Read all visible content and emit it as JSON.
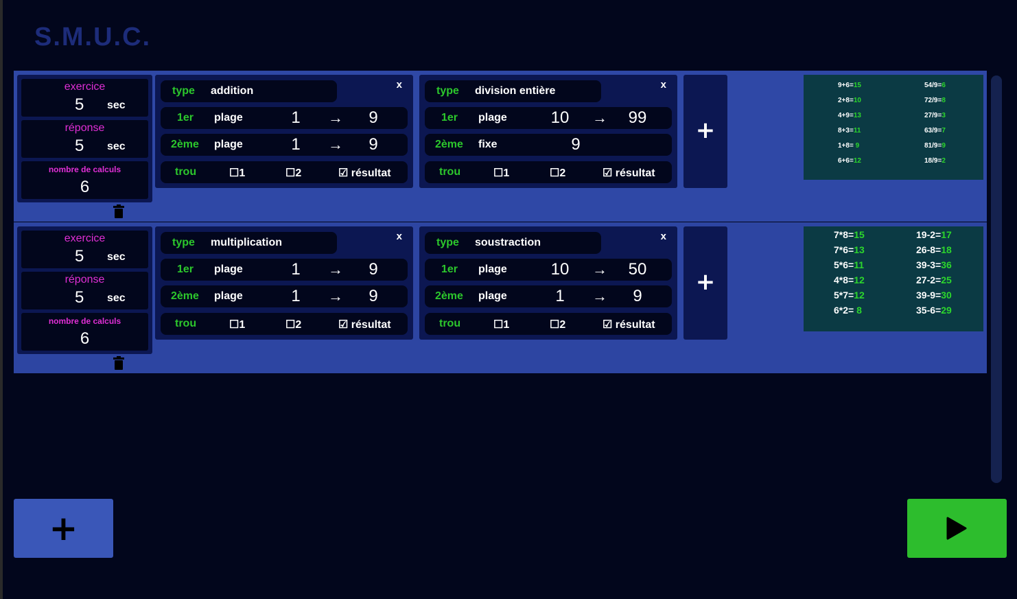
{
  "app": {
    "logo": "S.M.U.C."
  },
  "groups": [
    {
      "settings": {
        "exercise_label": "exercice",
        "exercise_value": "5",
        "exercise_unit": "sec",
        "answer_label": "réponse",
        "answer_value": "5",
        "answer_unit": "sec",
        "count_label": "nombre de calculs",
        "count_value": "6"
      },
      "operations": [
        {
          "type_label": "type",
          "type_value": "addition",
          "close": "x",
          "first_label": "1er",
          "first_mode": "plage",
          "first_from": "1",
          "first_arrow": "→",
          "first_to": "9",
          "second_label": "2ème",
          "second_mode": "plage",
          "second_from": "1",
          "second_arrow": "→",
          "second_to": "9",
          "hole_label": "trou",
          "hole_1": "☐1",
          "hole_2": "☐2",
          "hole_result": "☑ résultat"
        },
        {
          "type_label": "type",
          "type_value": "division entière",
          "close": "x",
          "first_label": "1er",
          "first_mode": "plage",
          "first_from": "10",
          "first_arrow": "→",
          "first_to": "99",
          "second_label": "2ème",
          "second_mode": "fixe",
          "second_from": "9",
          "second_arrow": "",
          "second_to": "",
          "hole_label": "trou",
          "hole_1": "☐1",
          "hole_2": "☐2",
          "hole_result": "☑ résultat"
        }
      ],
      "add_operation": "+",
      "preview": {
        "col1": [
          {
            "q": "9+6=",
            "a": "15"
          },
          {
            "q": "2+8=",
            "a": "10"
          },
          {
            "q": "4+9=",
            "a": "13"
          },
          {
            "q": "8+3=",
            "a": "11"
          },
          {
            "q": "1+8=",
            "a": " 9"
          },
          {
            "q": "6+6=",
            "a": "12"
          }
        ],
        "col2": [
          {
            "q": "54/9=",
            "a": "6"
          },
          {
            "q": "72/9=",
            "a": "8"
          },
          {
            "q": "27/9=",
            "a": "3"
          },
          {
            "q": "63/9=",
            "a": "7"
          },
          {
            "q": "81/9=",
            "a": "9"
          },
          {
            "q": "18/9=",
            "a": "2"
          }
        ]
      }
    },
    {
      "settings": {
        "exercise_label": "exercice",
        "exercise_value": "5",
        "exercise_unit": "sec",
        "answer_label": "réponse",
        "answer_value": "5",
        "answer_unit": "sec",
        "count_label": "nombre de calculs",
        "count_value": "6"
      },
      "operations": [
        {
          "type_label": "type",
          "type_value": "multiplication",
          "close": "x",
          "first_label": "1er",
          "first_mode": "plage",
          "first_from": "1",
          "first_arrow": "→",
          "first_to": "9",
          "second_label": "2ème",
          "second_mode": "plage",
          "second_from": "1",
          "second_arrow": "→",
          "second_to": "9",
          "hole_label": "trou",
          "hole_1": "☐1",
          "hole_2": "☐2",
          "hole_result": "☑ résultat"
        },
        {
          "type_label": "type",
          "type_value": "soustraction",
          "close": "x",
          "first_label": "1er",
          "first_mode": "plage",
          "first_from": "10",
          "first_arrow": "→",
          "first_to": "50",
          "second_label": "2ème",
          "second_mode": "plage",
          "second_from": "1",
          "second_arrow": "→",
          "second_to": "9",
          "hole_label": "trou",
          "hole_1": "☐1",
          "hole_2": "☐2",
          "hole_result": "☑ résultat"
        }
      ],
      "add_operation": "+",
      "preview": {
        "col1": [
          {
            "q": "7*8=",
            "a": "15"
          },
          {
            "q": "7*6=",
            "a": "13"
          },
          {
            "q": "5*6=",
            "a": "11"
          },
          {
            "q": "4*8=",
            "a": "12"
          },
          {
            "q": "5*7=",
            "a": "12"
          },
          {
            "q": "6*2=",
            "a": " 8"
          }
        ],
        "col2": [
          {
            "q": "19-2=",
            "a": "17"
          },
          {
            "q": "26-8=",
            "a": "18"
          },
          {
            "q": "39-3=",
            "a": "36"
          },
          {
            "q": "27-2=",
            "a": "25"
          },
          {
            "q": "39-9=",
            "a": "30"
          },
          {
            "q": "35-6=",
            "a": "29"
          }
        ]
      }
    }
  ],
  "controls": {
    "add_group": "+",
    "play_icon": "play-icon"
  },
  "colors": {
    "background": "#02061c",
    "group": "#2f48a6",
    "panel": "#0c1752",
    "label_magenta": "#e12fd6",
    "label_green": "#2cc72c",
    "play": "#2dbd2d",
    "add": "#3a57b8"
  }
}
